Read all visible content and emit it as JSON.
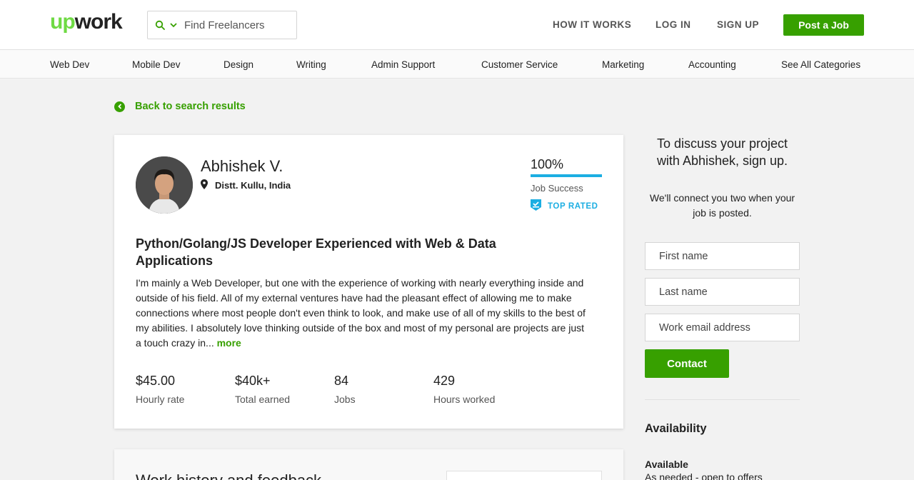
{
  "brand": {
    "logo_up": "up",
    "logo_work": "work",
    "accent": "#37a000",
    "logo_green": "#6fda44",
    "job_success_color": "#1caee2"
  },
  "search": {
    "placeholder": "Find Freelancers"
  },
  "topnav": {
    "how_it_works": "HOW IT WORKS",
    "log_in": "LOG IN",
    "sign_up": "SIGN UP",
    "post_job": "Post a Job"
  },
  "categories": [
    "Web Dev",
    "Mobile Dev",
    "Design",
    "Writing",
    "Admin Support",
    "Customer Service",
    "Marketing",
    "Accounting",
    "See All Categories"
  ],
  "back_link": "Back to search results",
  "profile": {
    "name": "Abhishek V.",
    "location": "Distt. Kullu, India",
    "job_success_value": "100%",
    "job_success_label": "Job Success",
    "top_rated": "TOP RATED",
    "title": "Python/Golang/JS Developer Experienced with Web & Data Applications",
    "description": "I'm mainly a Web Developer, but one with the experience of working with nearly everything inside and outside of his field. All of my external ventures have had the pleasant effect of allowing me to make connections where most people don't even think to look, and make use of all of my skills to the best of my abilities. I absolutely love thinking outside of the box and most of my personal are projects are just a touch crazy in...",
    "more": "more",
    "stats": [
      {
        "value": "$45.00",
        "label": "Hourly rate"
      },
      {
        "value": "$40k+",
        "label": "Total earned"
      },
      {
        "value": "84",
        "label": "Jobs"
      },
      {
        "value": "429",
        "label": "Hours worked"
      }
    ]
  },
  "work_history": {
    "heading": "Work history and feedback"
  },
  "sidebar": {
    "heading": "To discuss your project with Abhishek, sign up.",
    "subtext": "We'll connect you two when your job is posted.",
    "first_name_placeholder": "First name",
    "last_name_placeholder": "Last name",
    "email_placeholder": "Work email address",
    "contact_label": "Contact",
    "availability_heading": "Availability",
    "availability_status": "Available",
    "availability_detail": "As needed - open to offers"
  },
  "icons": [
    "search-icon",
    "chevron-down-icon",
    "back-arrow-icon",
    "location-pin-icon",
    "top-rated-badge-icon"
  ]
}
